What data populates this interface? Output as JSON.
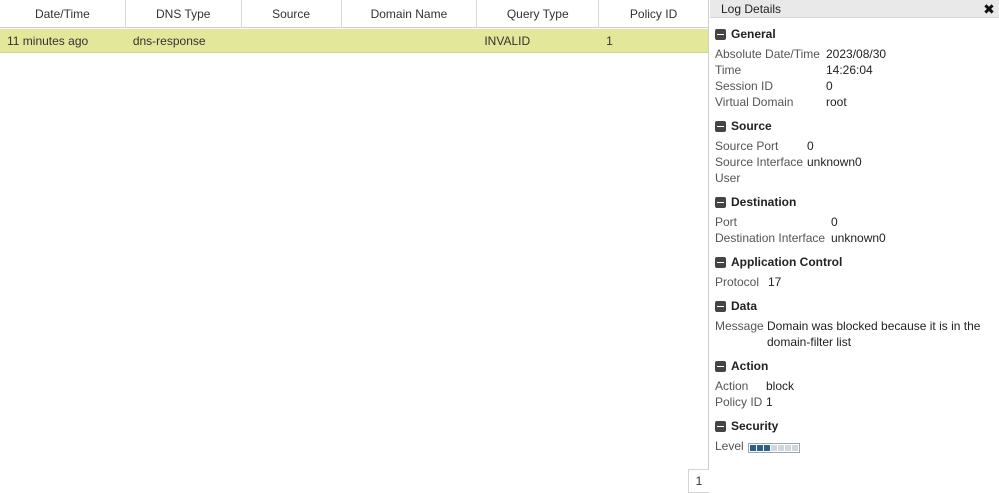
{
  "table": {
    "columns": [
      "Date/Time",
      "DNS Type",
      "Source",
      "Domain Name",
      "Query Type",
      "Policy ID"
    ],
    "rows": [
      [
        "11 minutes ago",
        "dns-response",
        "",
        "",
        "INVALID",
        "1"
      ]
    ]
  },
  "pager": {
    "page": "1"
  },
  "details": {
    "title": "Log Details",
    "close_icon": "close-icon",
    "general": {
      "title": "General",
      "fields": [
        {
          "k": "Absolute Date/Time",
          "v": "2023/08/30"
        },
        {
          "k": "Time",
          "v": "14:26:04"
        },
        {
          "k": "Session ID",
          "v": "0"
        },
        {
          "k": "Virtual Domain",
          "v": "root"
        }
      ]
    },
    "source": {
      "title": "Source",
      "fields": [
        {
          "k": "Source Port",
          "v": "0"
        },
        {
          "k": "Source Interface",
          "v": "unknown0"
        },
        {
          "k": "User",
          "v": ""
        }
      ]
    },
    "destination": {
      "title": "Destination",
      "fields": [
        {
          "k": "Port",
          "v": "0"
        },
        {
          "k": "Destination Interface",
          "v": "unknown0"
        }
      ]
    },
    "application_control": {
      "title": "Application Control",
      "fields": [
        {
          "k": "Protocol",
          "v": "17"
        }
      ]
    },
    "data": {
      "title": "Data",
      "fields": [
        {
          "k": "Message",
          "v": "Domain was blocked because it is in the domain-filter list"
        }
      ]
    },
    "action": {
      "title": "Action",
      "fields": [
        {
          "k": "Action",
          "v": "block"
        },
        {
          "k": "Policy ID",
          "v": "1"
        }
      ]
    },
    "security": {
      "title": "Security",
      "level_label": "Level",
      "level_value": 3,
      "level_max": 7
    }
  },
  "colors": {
    "selected_row": "#e3e79a",
    "level_on": "#2e5f86",
    "level_off": "#cfd6dc"
  }
}
